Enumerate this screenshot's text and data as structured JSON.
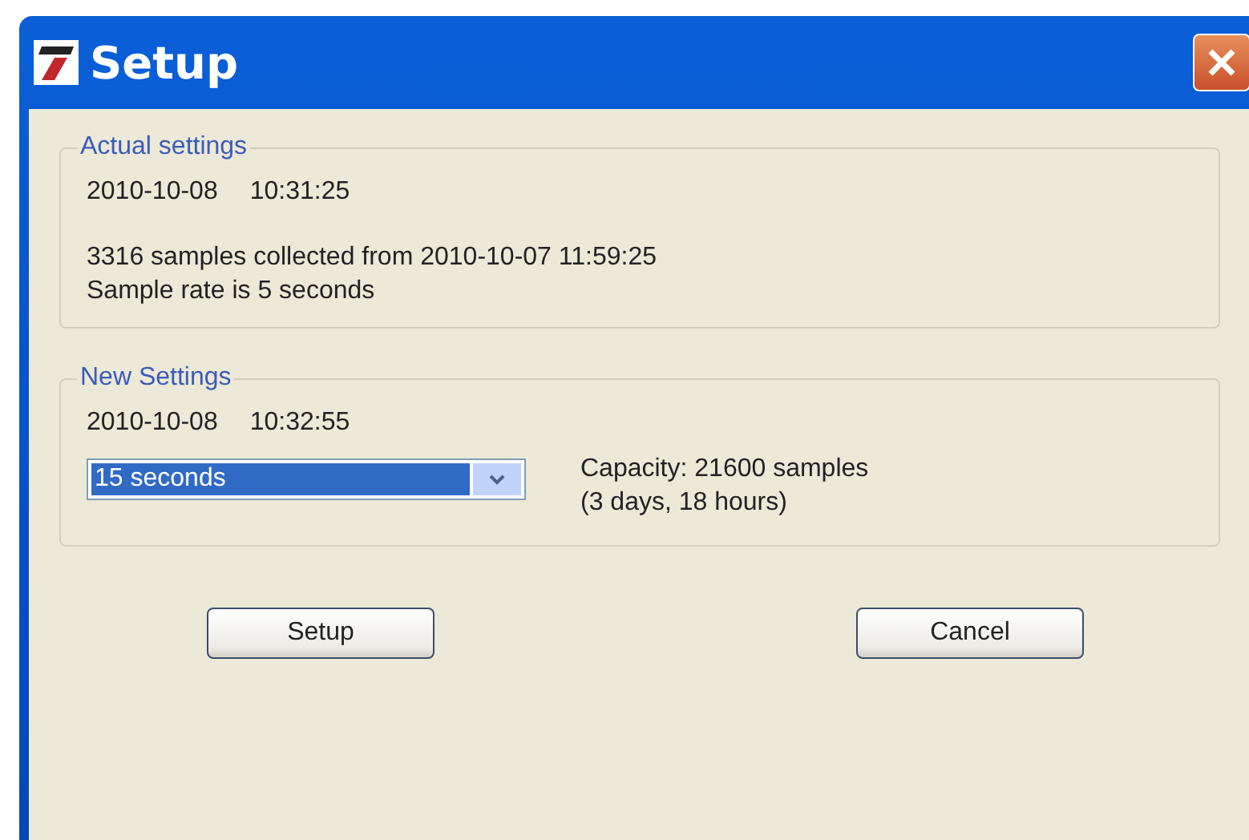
{
  "window": {
    "title": "Setup"
  },
  "actual_settings": {
    "legend": "Actual settings",
    "date": "2010-10-08",
    "time": "10:31:25",
    "lines": [
      "3316 samples collected from 2010-10-07 11:59:25",
      "Sample rate is 5 seconds"
    ]
  },
  "new_settings": {
    "legend": "New Settings",
    "date": "2010-10-08",
    "time": "10:32:55",
    "rate": {
      "value": "15 seconds",
      "selected": true
    },
    "capacity": [
      "Capacity: 21600 samples",
      "(3 days, 18 hours)"
    ]
  },
  "buttons": [
    {
      "label": "Setup"
    },
    {
      "label": "Cancel"
    }
  ]
}
